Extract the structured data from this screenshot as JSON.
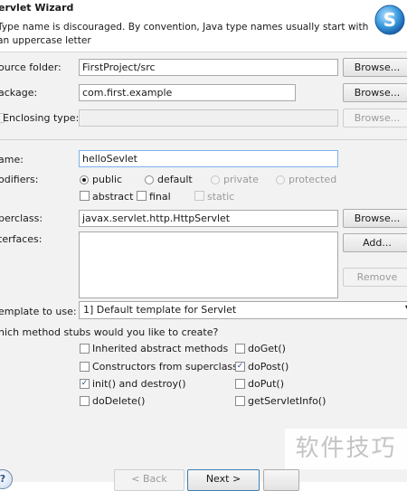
{
  "wizard": {
    "title": "ervlet Wizard",
    "warning_line1": "Type name is discouraged. By convention, Java type names usually start with",
    "warning_line2": "an uppercase letter",
    "logo_letter": "S"
  },
  "form": {
    "source_folder": {
      "label": "ource folder:",
      "value": "FirstProject/src",
      "browse": "Browse..."
    },
    "package": {
      "label": "ackage:",
      "value": "com.first.example",
      "browse": "Browse..."
    },
    "enclosing_type": {
      "label": "Enclosing type:",
      "value": "",
      "browse": "Browse..."
    },
    "name": {
      "label": "ame:",
      "value": "helloSevlet"
    },
    "modifiers": {
      "label": "odifiers:",
      "public": "public",
      "default": "default",
      "private": "private",
      "protected": "protected",
      "abstract": "abstract",
      "final": "final",
      "static": "static"
    },
    "superclass": {
      "label": "perclass:",
      "value": "javax.servlet.http.HttpServlet",
      "browse": "Browse..."
    },
    "interfaces": {
      "label": "terfaces:",
      "add": "Add...",
      "remove": "Remove"
    },
    "template": {
      "label": "emplate to use:",
      "value": "1] Default template for Servlet",
      "arrow": "▼"
    },
    "stubs": {
      "question": "hich method stubs would you like to create?",
      "inherited": "Inherited abstract methods",
      "constructors": "Constructors from superclass",
      "init_destroy": "init() and destroy()",
      "doDelete": "doDelete()",
      "doGet": "doGet()",
      "doPost": "doPost()",
      "doPut": "doPut()",
      "getServletInfo": "getServletInfo()"
    }
  },
  "footer": {
    "help": "?",
    "back": "< Back",
    "next": "Next >"
  },
  "watermark": "软件技巧",
  "checkmark": "✓"
}
